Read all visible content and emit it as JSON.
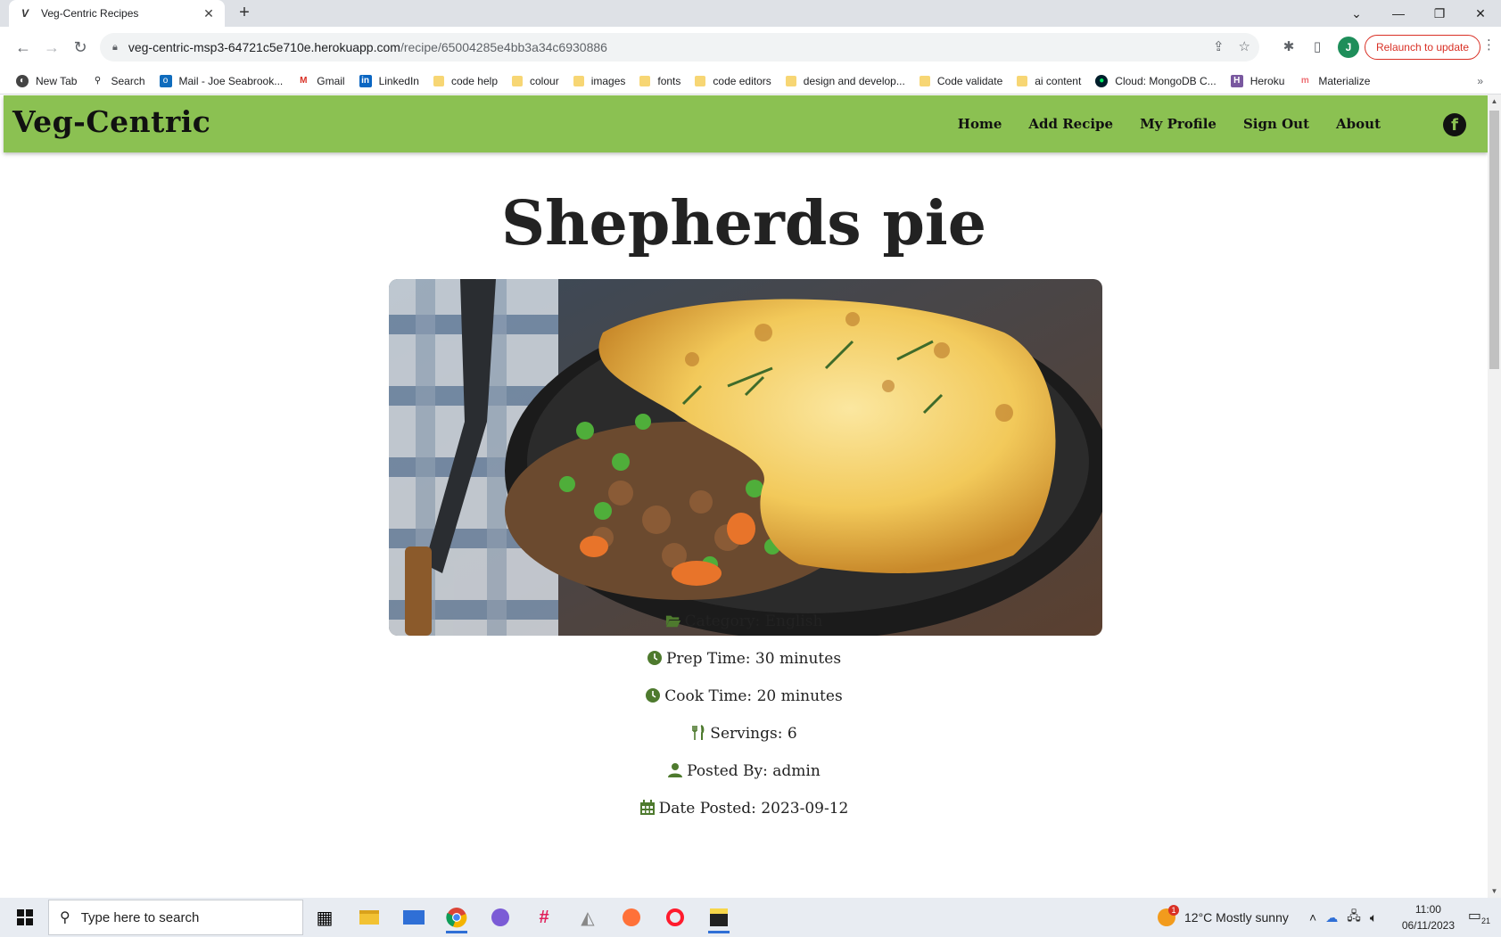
{
  "browser": {
    "tab_title": "Veg-Centric Recipes",
    "tab_close": "✕",
    "new_tab": "+",
    "url_host": "veg-centric-msp3-64721c5e710e.herokuapp.com",
    "url_path": "/recipe/65004285e4bb3a34c6930886",
    "profile_initial": "J",
    "relaunch_label": "Relaunch to update",
    "bookmarks": [
      {
        "label": "New Tab",
        "icon": "globe-icon"
      },
      {
        "label": "Search",
        "icon": "search-icon"
      },
      {
        "label": "Mail - Joe Seabrook...",
        "icon": "outlook-icon"
      },
      {
        "label": "Gmail",
        "icon": "gmail-icon"
      },
      {
        "label": "LinkedIn",
        "icon": "linkedin-icon"
      },
      {
        "label": "code help",
        "icon": "folder-icon"
      },
      {
        "label": "colour",
        "icon": "folder-icon"
      },
      {
        "label": "images",
        "icon": "folder-icon"
      },
      {
        "label": "fonts",
        "icon": "folder-icon"
      },
      {
        "label": "code editors",
        "icon": "folder-icon"
      },
      {
        "label": "design and develop...",
        "icon": "folder-icon"
      },
      {
        "label": "Code validate",
        "icon": "folder-icon"
      },
      {
        "label": "ai content",
        "icon": "folder-icon"
      },
      {
        "label": "Cloud: MongoDB C...",
        "icon": "mongodb-icon"
      },
      {
        "label": "Heroku",
        "icon": "heroku-icon"
      },
      {
        "label": "Materialize",
        "icon": "materialize-icon"
      }
    ],
    "bookmarks_more": "»"
  },
  "site": {
    "brand": "Veg-Centric",
    "nav": [
      "Home",
      "Add Recipe",
      "My Profile",
      "Sign Out",
      "About"
    ],
    "social_icon": "facebook-icon",
    "accent_color": "#8bc152"
  },
  "recipe": {
    "title": "Shepherds pie",
    "image_alt": "Shepherds pie",
    "category": "Category: English",
    "prep_time": "Prep Time: 30 minutes",
    "cook_time": "Cook Time: 20 minutes",
    "servings": "Servings: 6",
    "posted_by": "Posted By: admin",
    "date_posted": "Date Posted: 2023-09-12"
  },
  "taskbar": {
    "search_placeholder": "Type here to search",
    "weather": "12°C  Mostly sunny",
    "weather_badge": "1",
    "time": "11:00",
    "date": "06/11/2023",
    "notifications": "21"
  }
}
